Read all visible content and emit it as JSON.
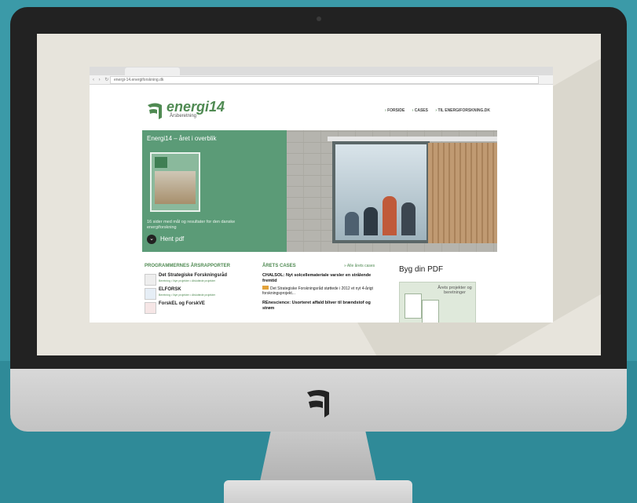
{
  "browser": {
    "url": "energi-14.energiforskning.dk"
  },
  "site": {
    "logo_text": "energi14",
    "logo_sub": "Årsberetning",
    "nav": [
      "FORSIDE",
      "CASES",
      "TIL ENERGIFORSKNING.DK"
    ]
  },
  "hero": {
    "title": "Energi14 – året i overblik",
    "description": "16 sider med mål og resultater for den danske energiforskning",
    "button_label": "Hent pdf"
  },
  "programs": {
    "title": "PROGRAMMERNES ÅRSRAPPORTER",
    "items": [
      {
        "name": "Det Strategiske Forskningsråd",
        "sub": "Beretning • Nye projekter • Afsluttede projekter"
      },
      {
        "name": "ELFORSK",
        "sub": "Beretning • Nye projekter • Afsluttede projekter"
      },
      {
        "name": "ForskEL og ForskVE",
        "sub": ""
      }
    ]
  },
  "cases": {
    "title": "ÅRETS CASES",
    "all_link": "» Alle årets cases",
    "items": [
      {
        "title": "CHALSOL: Nyt solcellemateriale varsler en strålende fremtid",
        "text": "Det Strategiske Forskningsråd støttede i 2012 et nyt 4-årigt forskningsprojekt..."
      },
      {
        "title": "REnescience: Usorteret affald bliver til brændstof og strøm",
        "text": ""
      }
    ]
  },
  "pdf": {
    "title": "Byg din PDF",
    "card_label": "Årets projekter og beretninger"
  },
  "colors": {
    "background": "#3a98a6",
    "brand_green": "#4f8a52",
    "hero_green": "#5b9b77"
  }
}
